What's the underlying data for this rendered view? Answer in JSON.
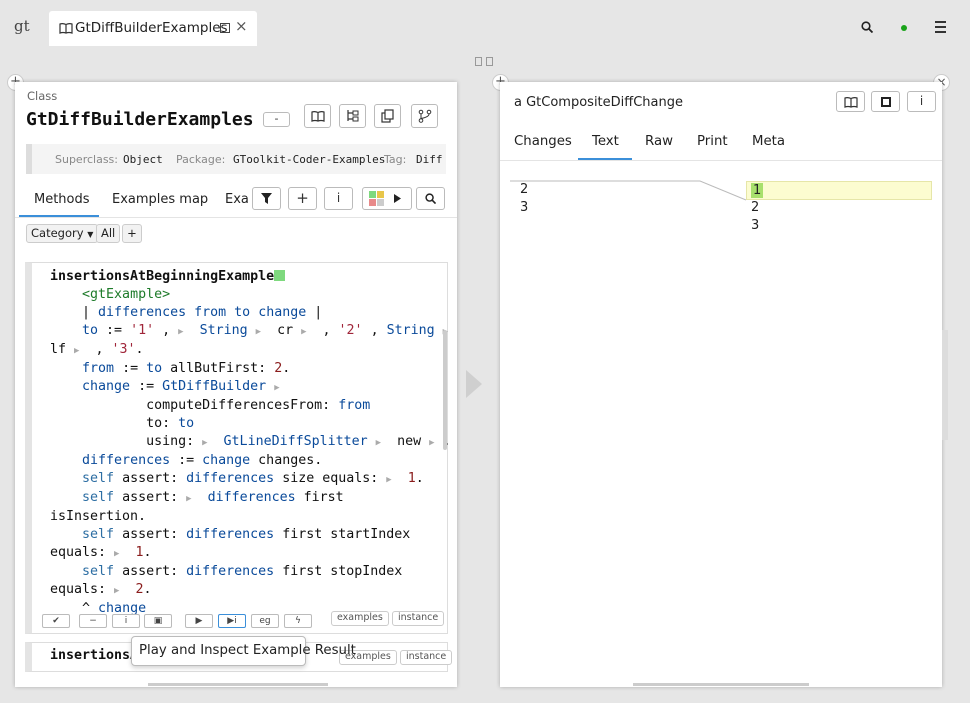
{
  "topbar": {
    "logo": "gt",
    "tab_title": "GtDiffBuilderExamples"
  },
  "left": {
    "class_label": "Class",
    "class_name": "GtDiffBuilderExamples",
    "collapse": "-",
    "meta": {
      "superclass_key": "Superclass:",
      "superclass_val": "Object",
      "package_key": "Package:",
      "package_val": "GToolkit-Coder-Examples",
      "tag_key": "Tag:",
      "tag_val": "Diff"
    },
    "tabs": [
      "Methods",
      "Examples map",
      "Exa"
    ],
    "filter": {
      "category": "Category",
      "all": "All",
      "add": "+"
    },
    "code": {
      "method1": "insertionsAtBeginningExample",
      "pragma": "<gtExample>",
      "tools": {
        "examples": "examples",
        "instance": "instance",
        "eg": "eg"
      },
      "method2": "insertionsA"
    },
    "tooltip": "Play and Inspect Example Result"
  },
  "right": {
    "title": "a GtCompositeDiffChange",
    "tabs": [
      "Changes",
      "Text",
      "Raw",
      "Print",
      "Meta"
    ],
    "diff": {
      "left_lines": [
        "2",
        "3"
      ],
      "right_lines": [
        "1",
        "2",
        "3"
      ]
    }
  },
  "colors": {
    "accent": "#3b8fd9",
    "insert_highlight": "#fcfcd0",
    "insert_mark": "#a8e06c",
    "status_dot": "#1aa31a"
  }
}
